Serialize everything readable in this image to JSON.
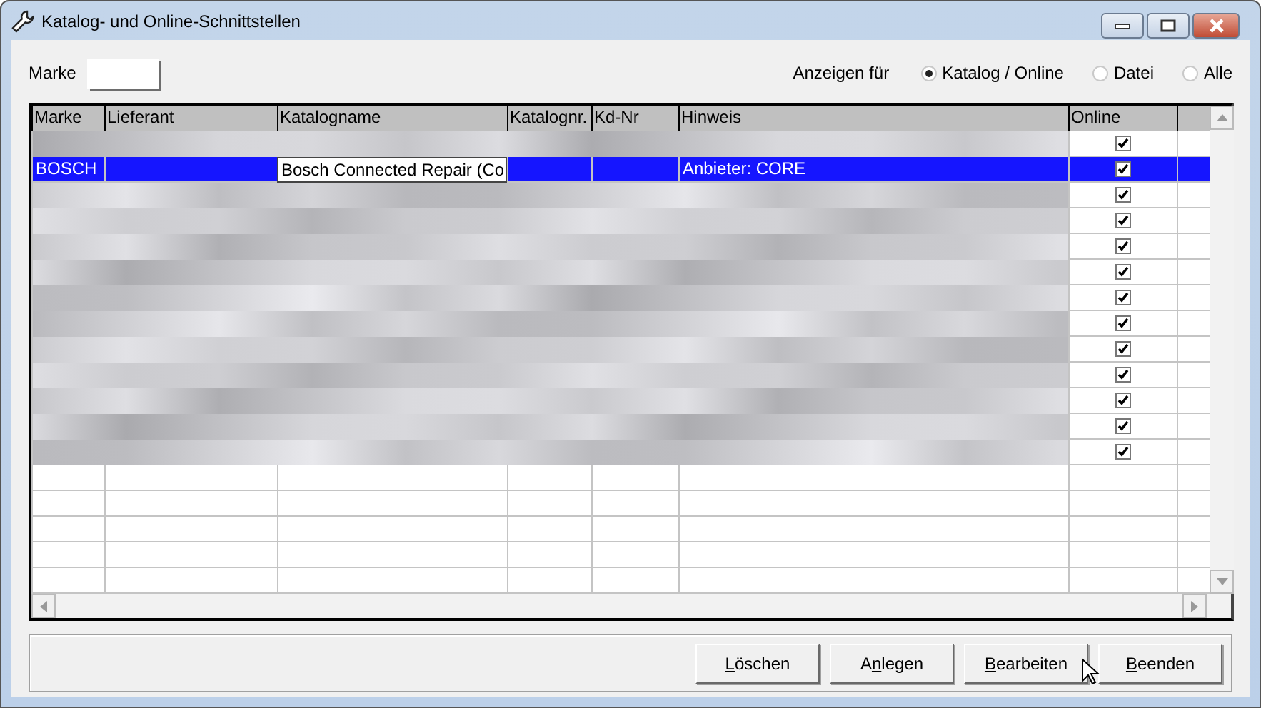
{
  "window": {
    "title": "Katalog- und Online-Schnittstellen"
  },
  "marke_field": {
    "label": "Marke"
  },
  "filter": {
    "label": "Anzeigen für",
    "options": [
      {
        "label": "Katalog / Online",
        "selected": true
      },
      {
        "label": "Datei",
        "selected": false
      },
      {
        "label": "Alle",
        "selected": false
      }
    ]
  },
  "table": {
    "columns": [
      "Marke",
      "Lieferant",
      "Katalogname",
      "Katalognr.",
      "Kd-Nr",
      "Hinweis",
      "Online"
    ],
    "rows": [
      {
        "kind": "blurred",
        "online": true
      },
      {
        "kind": "data",
        "selected": true,
        "cells": [
          "BOSCH",
          "",
          "Bosch Connected Repair (Co",
          "",
          "",
          "Anbieter: CORE"
        ],
        "online": true
      },
      {
        "kind": "blurred",
        "online": true
      },
      {
        "kind": "blurred",
        "online": true
      },
      {
        "kind": "blurred",
        "online": true
      },
      {
        "kind": "blurred",
        "online": true
      },
      {
        "kind": "blurred",
        "online": true
      },
      {
        "kind": "blurred",
        "online": true
      },
      {
        "kind": "blurred",
        "online": true
      },
      {
        "kind": "blurred",
        "online": true
      },
      {
        "kind": "blurred",
        "online": true
      },
      {
        "kind": "blurred",
        "online": true
      },
      {
        "kind": "blurred",
        "online": true
      },
      {
        "kind": "empty"
      },
      {
        "kind": "empty"
      },
      {
        "kind": "empty"
      },
      {
        "kind": "empty"
      },
      {
        "kind": "empty"
      }
    ]
  },
  "buttons": [
    {
      "mnemonic": "L",
      "after": "öschen"
    },
    {
      "before": "A",
      "mnemonic": "n",
      "after": "legen"
    },
    {
      "mnemonic": "B",
      "after": "earbeiten"
    },
    {
      "mnemonic": "B",
      "after": "eenden"
    }
  ]
}
